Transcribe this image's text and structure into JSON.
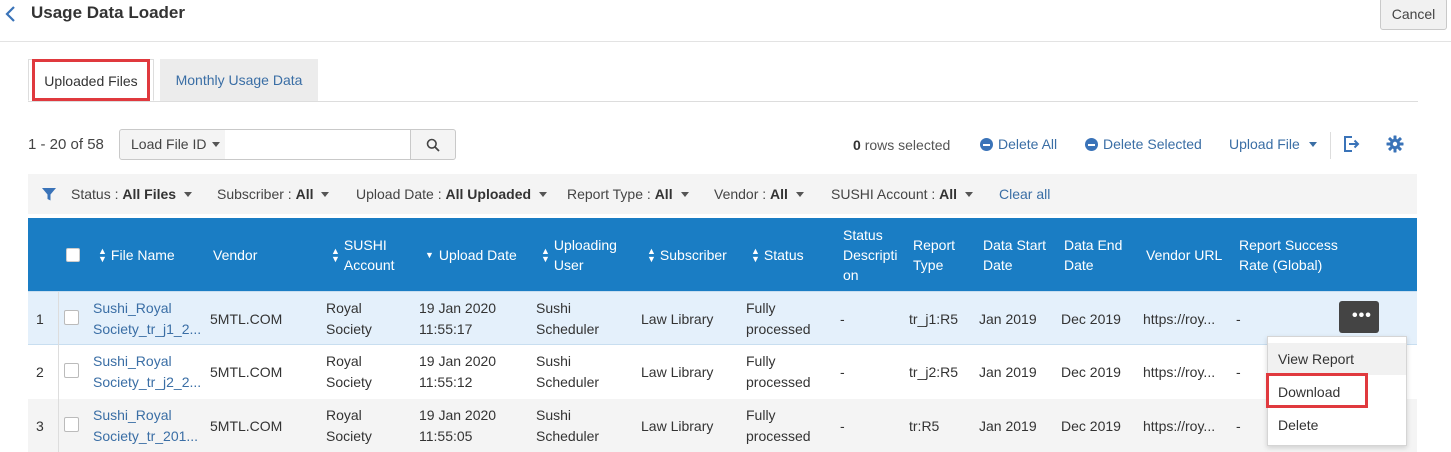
{
  "header": {
    "title": "Usage Data Loader",
    "cancel_label": "Cancel"
  },
  "tabs": [
    {
      "label": "Uploaded Files",
      "active": true
    },
    {
      "label": "Monthly Usage Data",
      "active": false
    }
  ],
  "toolbar": {
    "range": "1 - 20 of 58",
    "search_field": "Load File ID",
    "search_value": "",
    "rows_selected_count": "0",
    "rows_selected_label": "rows selected",
    "delete_all": "Delete All",
    "delete_selected": "Delete Selected",
    "upload_file": "Upload File"
  },
  "filters": [
    {
      "label": "Status :",
      "value": "All Files"
    },
    {
      "label": "Subscriber :",
      "value": "All"
    },
    {
      "label": "Upload Date :",
      "value": "All Uploaded"
    },
    {
      "label": "Report Type :",
      "value": "All"
    },
    {
      "label": "Vendor :",
      "value": "All"
    },
    {
      "label": "SUSHI Account :",
      "value": "All"
    }
  ],
  "clear_all": "Clear all",
  "columns": {
    "file_name": "File Name",
    "vendor": "Vendor",
    "sushi_1": "SUSHI",
    "sushi_2": "Account",
    "upload_date": "Upload Date",
    "uploading_1": "Uploading",
    "uploading_2": "User",
    "subscriber": "Subscriber",
    "status": "Status",
    "sdesc_1": "Status",
    "sdesc_2": "Descripti",
    "sdesc_3": "on",
    "rtype_1": "Report",
    "rtype_2": "Type",
    "dstart_1": "Data Start",
    "dstart_2": "Date",
    "dend_1": "Data End",
    "dend_2": "Date",
    "vendor_url": "Vendor URL",
    "rsr_1": "Report Success",
    "rsr_2": "Rate (Global)"
  },
  "rows": [
    {
      "num": "1",
      "file_1": "Sushi_Royal",
      "file_2": "Society_tr_j1_2...",
      "vendor": "5MTL.COM",
      "sushi_1": "Royal",
      "sushi_2": "Society",
      "date_1": "19 Jan 2020",
      "date_2": "11:55:17",
      "user_1": "Sushi",
      "user_2": "Scheduler",
      "subscriber": "Law Library",
      "status_1": "Fully",
      "status_2": "processed",
      "sdesc": "-",
      "rtype": "tr_j1:R5",
      "dstart": "Jan 2019",
      "dend": "Dec 2019",
      "url": "https://roy...",
      "rsr": "-"
    },
    {
      "num": "2",
      "file_1": "Sushi_Royal",
      "file_2": "Society_tr_j2_2...",
      "vendor": "5MTL.COM",
      "sushi_1": "Royal",
      "sushi_2": "Society",
      "date_1": "19 Jan 2020",
      "date_2": "11:55:12",
      "user_1": "Sushi",
      "user_2": "Scheduler",
      "subscriber": "Law Library",
      "status_1": "Fully",
      "status_2": "processed",
      "sdesc": "-",
      "rtype": "tr_j2:R5",
      "dstart": "Jan 2019",
      "dend": "Dec 2019",
      "url": "https://roy...",
      "rsr": "-"
    },
    {
      "num": "3",
      "file_1": "Sushi_Royal",
      "file_2": "Society_tr_201...",
      "vendor": "5MTL.COM",
      "sushi_1": "Royal",
      "sushi_2": "Society",
      "date_1": "19 Jan 2020",
      "date_2": "11:55:05",
      "user_1": "Sushi",
      "user_2": "Scheduler",
      "subscriber": "Law Library",
      "status_1": "Fully",
      "status_2": "processed",
      "sdesc": "-",
      "rtype": "tr:R5",
      "dstart": "Jan 2019",
      "dend": "Dec 2019",
      "url": "https://roy...",
      "rsr": "-"
    }
  ],
  "row_menu": {
    "more_label": "•••",
    "items": [
      "View Report",
      "Download",
      "Delete"
    ]
  },
  "colors": {
    "accent": "#1a7dc4",
    "link": "#3a6ea5",
    "highlight": "#e0393e"
  }
}
